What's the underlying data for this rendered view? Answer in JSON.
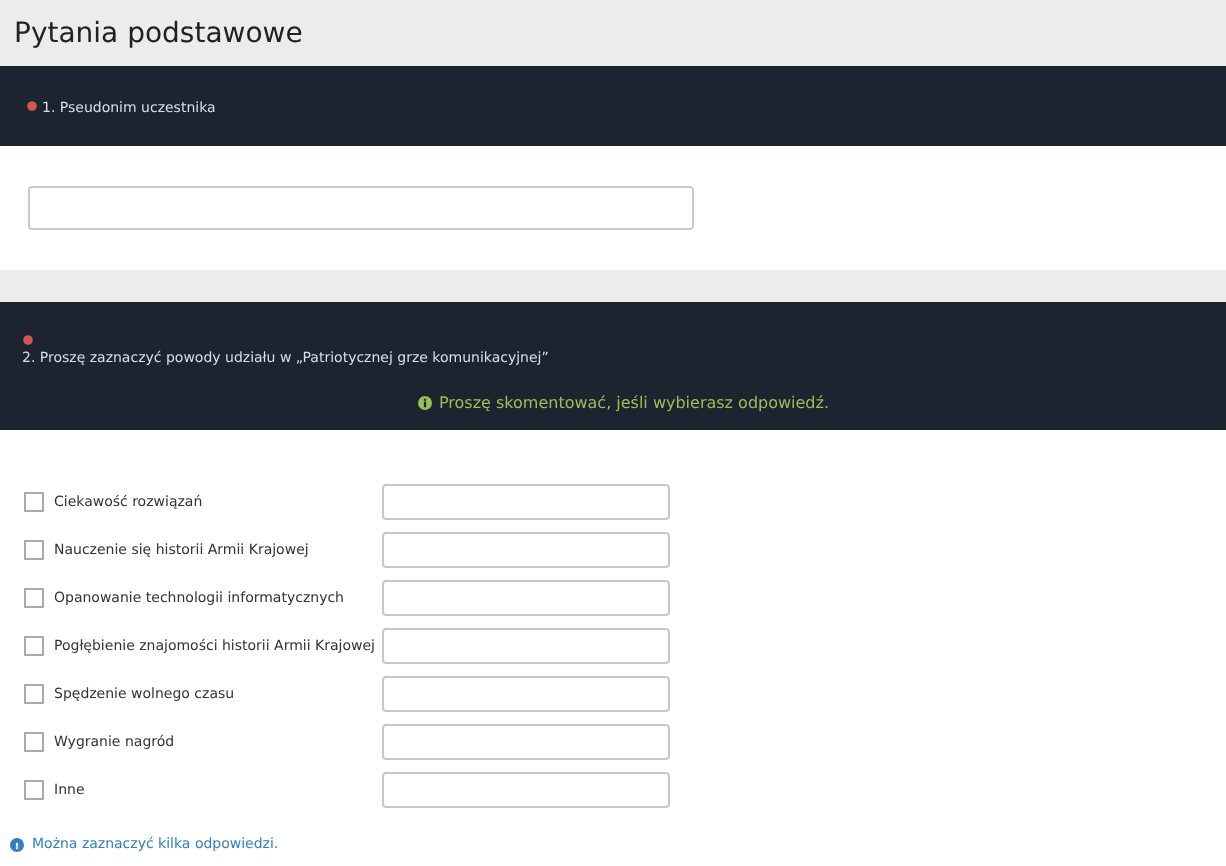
{
  "page_title": "Pytania podstawowe",
  "questions": [
    {
      "number_label": "1. Pseudonim uczestnika",
      "required": true,
      "kind": "text"
    },
    {
      "number_label": "2. Proszę zaznaczyć powody udziału w „Patriotycznej grze komunikacyjnej”",
      "required": true,
      "kind": "checklist",
      "hint": "Proszę skomentować, jeśli wybierasz odpowiedź.",
      "options": [
        {
          "label": "Ciekawość rozwiązań",
          "checked": false
        },
        {
          "label": "Nauczenie się historii Armii Krajowej",
          "checked": false
        },
        {
          "label": "Opanowanie technologii informatycznych",
          "checked": false
        },
        {
          "label": "Pogłębienie znajomości historii Armii Krajowej",
          "checked": false
        },
        {
          "label": "Spędzenie wolnego czasu",
          "checked": false
        },
        {
          "label": "Wygranie nagród",
          "checked": false
        },
        {
          "label": "Inne",
          "checked": false
        }
      ],
      "footer_note": "Można zaznaczyć kilka odpowiedzi."
    }
  ]
}
